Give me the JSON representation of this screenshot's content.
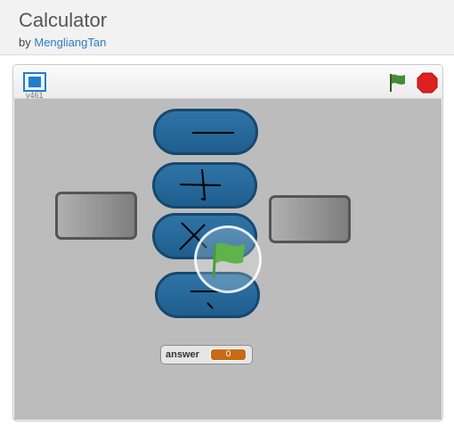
{
  "project": {
    "title": "Calculator",
    "by_label": "by",
    "author": "MengliangTan"
  },
  "player": {
    "version": "v461",
    "icons": {
      "fullscreen": "fullscreen-icon",
      "green_flag": "green-flag-icon",
      "stop": "stop-sign-icon",
      "overlay_flag": "green-flag-icon"
    },
    "colors": {
      "accent_blue": "#1f5e8e",
      "flag_green": "#4a8a3b",
      "stop_red": "#e02020",
      "monitor_value": "#c96a16",
      "stage_gray": "#bcbcbc"
    }
  },
  "stage": {
    "operator_buttons": [
      {
        "name": "subtract",
        "glyph": "−"
      },
      {
        "name": "add",
        "glyph": "+"
      },
      {
        "name": "multiply",
        "glyph": "×"
      },
      {
        "name": "divide",
        "glyph": "÷"
      }
    ],
    "monitor": {
      "label": "answer",
      "value": "0"
    }
  }
}
